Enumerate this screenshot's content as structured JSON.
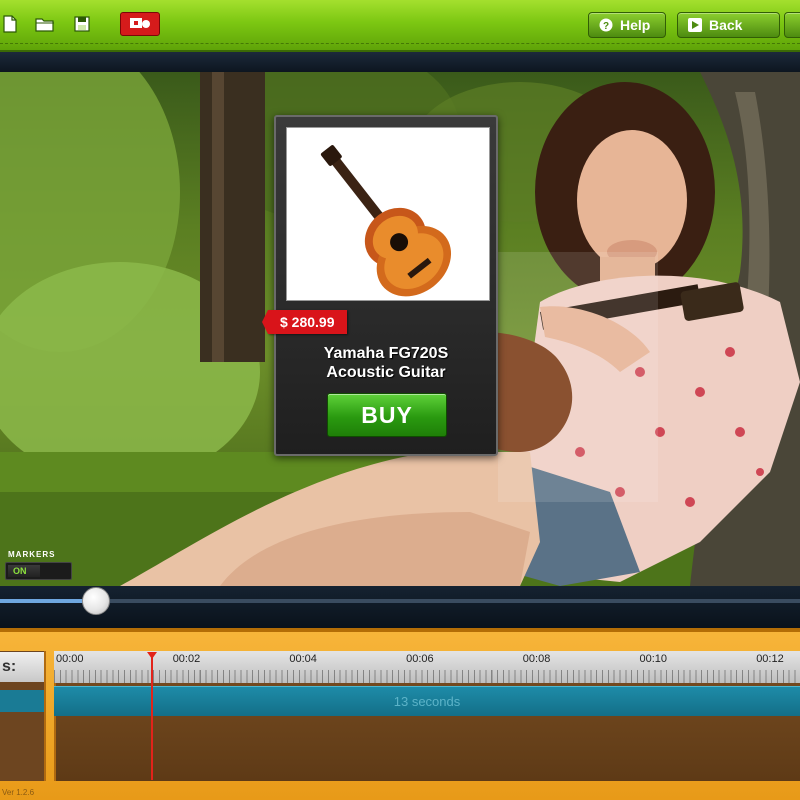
{
  "toolbar": {
    "icons": [
      "new-file-icon",
      "open-folder-icon",
      "save-icon",
      "presentation-icon"
    ],
    "help_label": "Help",
    "back_label": "Back"
  },
  "product": {
    "price": "$ 280.99",
    "name_line1": "Yamaha FG720S",
    "name_line2": "Acoustic Guitar",
    "buy_label": "BUY"
  },
  "markers": {
    "label": "MARKERS",
    "state": "ON"
  },
  "player": {
    "progress": 0.12
  },
  "timeline": {
    "left_label": "s:",
    "ticks": [
      "00:00",
      "00:02",
      "00:04",
      "00:06",
      "00:08",
      "00:10",
      "00:12"
    ],
    "clip_label": "13 seconds",
    "version": "Ver 1.2.6"
  },
  "colors": {
    "toolbar_green": "#7cc712",
    "buy_green": "#2a9a10",
    "price_red": "#d9141a",
    "timeline_orange": "#f2a728",
    "clip_teal": "#1a7b95",
    "playhead_red": "#e2231a"
  }
}
